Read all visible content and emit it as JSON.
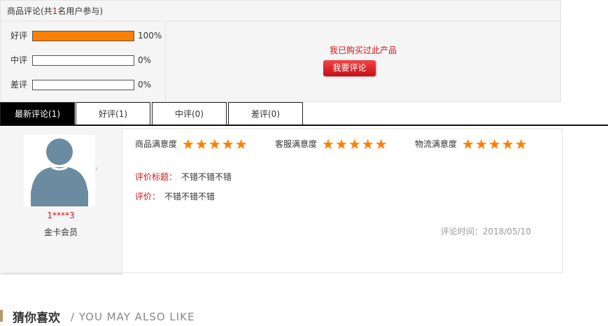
{
  "summary": {
    "title_prefix": "商品评论(共",
    "title_count": "1",
    "title_suffix": "名用户参与)",
    "ratings": [
      {
        "label": "好评",
        "percent_text": "100%",
        "fill": 1.0
      },
      {
        "label": "中评",
        "percent_text": "0%",
        "fill": 0.0
      },
      {
        "label": "差评",
        "percent_text": "0%",
        "fill": 0.0
      }
    ],
    "bought_text": "我已购买过此产品",
    "review_button": "我要评论",
    "colors": {
      "bar_fill": "#ff7f00",
      "accent_red": "#c8171d"
    }
  },
  "tabs": [
    {
      "label": "最新评论(1)",
      "active": true
    },
    {
      "label": "好评(1)",
      "active": false
    },
    {
      "label": "中评(0)",
      "active": false
    },
    {
      "label": "差评(0)",
      "active": false
    }
  ],
  "review": {
    "user": {
      "name": "1****3",
      "level": "金卡会员",
      "avatar_icon": "user-avatar-icon"
    },
    "satisfaction": [
      {
        "label": "商品满意度",
        "stars": 5
      },
      {
        "label": "客服满意度",
        "stars": 5
      },
      {
        "label": "物流满意度",
        "stars": 5
      }
    ],
    "title_key": "评价标题：",
    "title_value": "不错不错不错",
    "content_key": "评价：",
    "content_value": "不错不错不错",
    "time": "评论时间：2018/05/10"
  },
  "guess": {
    "title": "猜你喜欢",
    "subtitle": "/ YOU MAY ALSO LIKE"
  }
}
